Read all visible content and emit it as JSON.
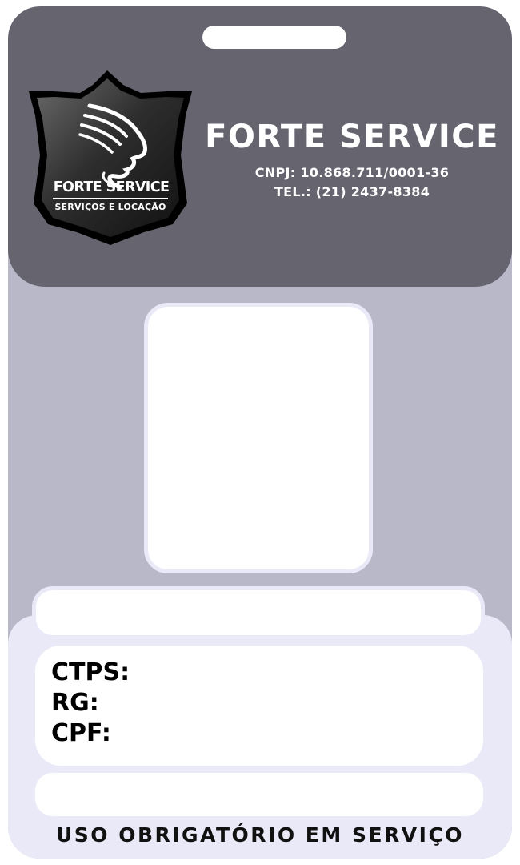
{
  "logo": {
    "icon": "head-profile-emblem-icon",
    "name": "FORTE SERVICE",
    "tagline": "SERVIÇOS E LOCAÇÃO"
  },
  "company": {
    "name": "FORTE SERVICE",
    "cnpj": "CNPJ: 10.868.711/0001-36",
    "tel": "TEL.: (21) 2437-8384"
  },
  "fields": {
    "ctps_label": "CTPS:",
    "rg_label": "RG:",
    "cpf_label": "CPF:"
  },
  "footer": {
    "note": "USO OBRIGATÓRIO EM SERVIÇO"
  },
  "colors": {
    "header": "#65646f",
    "body": "#b9b8c9",
    "lower_panel": "#eae9f7",
    "box": "#ffffff"
  }
}
